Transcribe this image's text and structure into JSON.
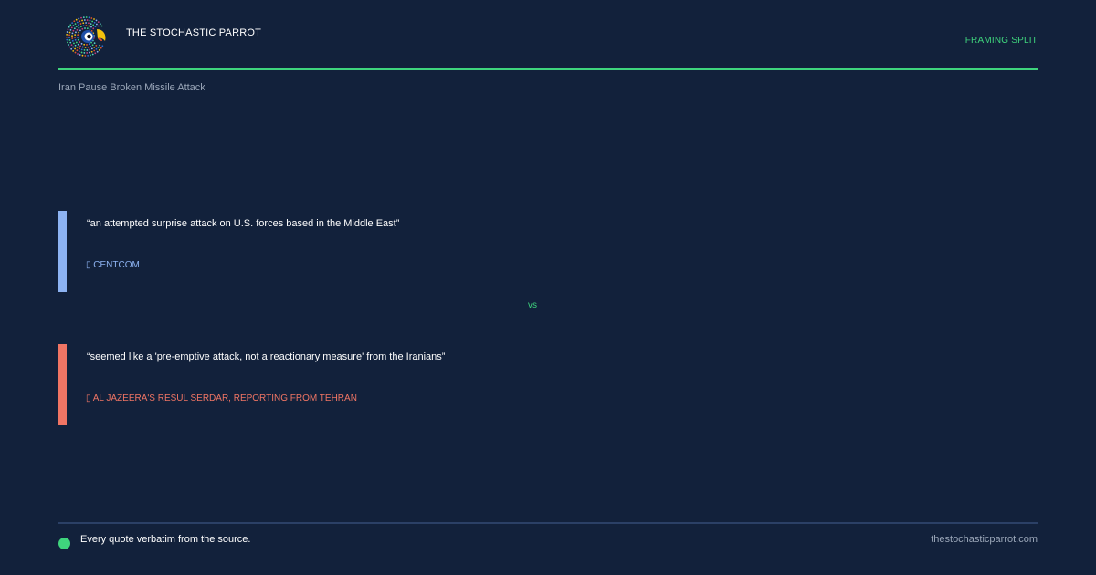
{
  "header": {
    "brand": "THE STOCHASTIC PARROT",
    "tag": "FRAMING SPLIT",
    "logo_icon": "parrot-logo-icon"
  },
  "topic": "Iran Pause Broken Missile Attack",
  "quotes": [
    {
      "text": "“an attempted surprise attack on U.S. forces based in the Middle East”",
      "source": "▯ CENTCOM",
      "color": "#8db3f2"
    },
    {
      "text": "“seemed like a 'pre-emptive attack, not a reactionary measure' from the Iranians”",
      "source": "▯ AL JAZEERA'S RESUL SERDAR, REPORTING FROM TEHRAN",
      "color": "#f07564"
    }
  ],
  "vs_label": "vs",
  "footer": {
    "note": "Every quote verbatim from the source.",
    "site": "thestochasticparrot.com"
  },
  "colors": {
    "background": "#12213b",
    "accent": "#3fd47d",
    "muted": "#9aa6b8"
  }
}
